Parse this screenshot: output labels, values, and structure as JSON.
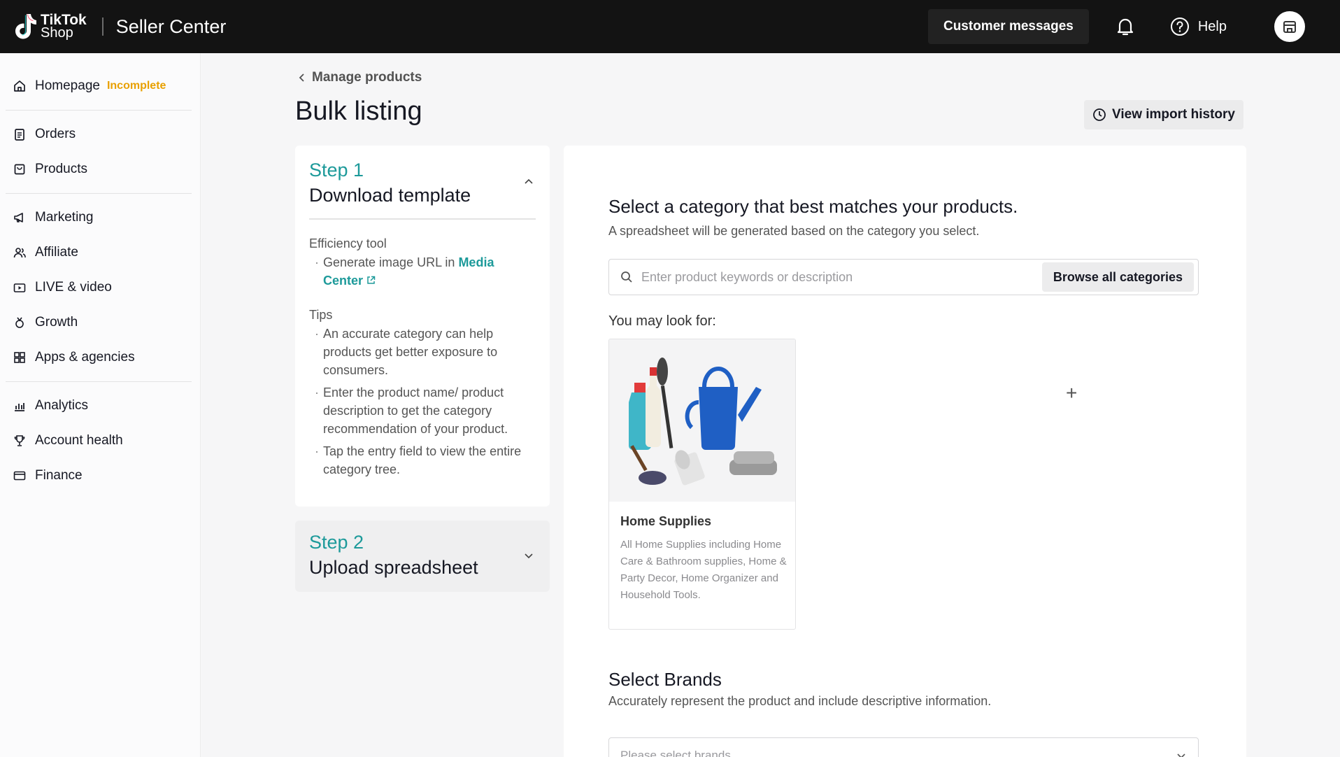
{
  "header": {
    "logo_line1": "TikTok",
    "logo_line2": "Shop",
    "title": "Seller Center",
    "customer_messages": "Customer messages",
    "help": "Help"
  },
  "sidebar": {
    "homepage": {
      "label": "Homepage",
      "badge": "Incomplete"
    },
    "items": [
      {
        "label": "Orders",
        "icon": "clipboard-icon"
      },
      {
        "label": "Products",
        "icon": "package-icon"
      },
      {
        "label": "Marketing",
        "icon": "megaphone-icon"
      },
      {
        "label": "Affiliate",
        "icon": "people-icon"
      },
      {
        "label": "LIVE & video",
        "icon": "video-icon"
      },
      {
        "label": "Growth",
        "icon": "medal-icon"
      },
      {
        "label": "Apps & agencies",
        "icon": "apps-icon"
      },
      {
        "label": "Analytics",
        "icon": "chart-icon"
      },
      {
        "label": "Account health",
        "icon": "trophy-icon"
      },
      {
        "label": "Finance",
        "icon": "card-icon"
      }
    ]
  },
  "breadcrumb": {
    "back_label": "Manage products"
  },
  "page": {
    "title": "Bulk listing",
    "import_history": "View import history"
  },
  "step1": {
    "label": "Step 1",
    "title": "Download template",
    "efficiency_label": "Efficiency tool",
    "efficiency_text": "Generate image URL in ",
    "efficiency_link": "Media Center",
    "tips_label": "Tips",
    "tips": [
      "An accurate category can help products get better exposure to consumers.",
      "Enter the product name/ product description to get the category recommendation of your product.",
      "Tap the entry field to view the entire category tree."
    ]
  },
  "step2": {
    "label": "Step 2",
    "title": "Upload spreadsheet"
  },
  "category": {
    "heading": "Select a category that best matches your products.",
    "subtext": "A spreadsheet will be generated based on the category you select.",
    "search_placeholder": "Enter product keywords or description",
    "search_value": "",
    "browse_button": "Browse all categories",
    "look_for": "You may look for:",
    "suggestion": {
      "name": "Home Supplies",
      "description": "All Home Supplies including Home Care & Bathroom supplies, Home & Party Decor, Home Organizer and Household Tools."
    }
  },
  "brands": {
    "heading": "Select Brands",
    "subtext": "Accurately represent the product and include descriptive information.",
    "placeholder": "Please select brands"
  },
  "colors": {
    "topbar": "#131313",
    "accent_teal": "#1d9a9a",
    "incomplete": "#e8a000",
    "watering_can": "#1f5fc4"
  }
}
